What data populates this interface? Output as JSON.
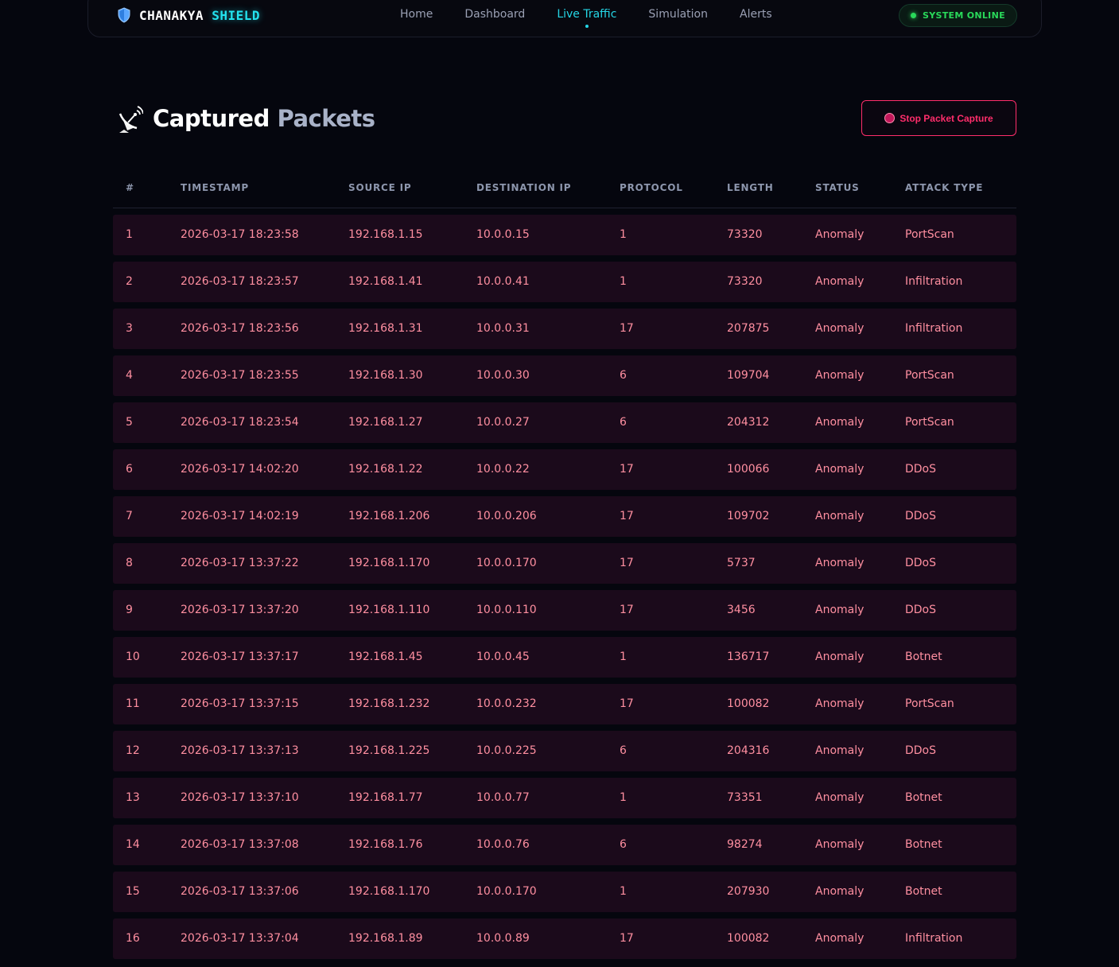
{
  "brand": {
    "name_part1": "CHANAKYA",
    "name_part2": "SHIELD"
  },
  "nav": {
    "links": [
      "Home",
      "Dashboard",
      "Live Traffic",
      "Simulation",
      "Alerts"
    ],
    "active": "Live Traffic"
  },
  "status": {
    "label": "SYSTEM ONLINE",
    "color": "#29d95a"
  },
  "page": {
    "title_part1": "Captured",
    "title_part2": "Packets",
    "icon": "satellite-dish-icon",
    "stop_button_label": "Stop Packet Capture"
  },
  "colors": {
    "accent": "#25d6e6",
    "danger": "#ff2d6b",
    "row_text": "#ff8fa0",
    "row_bg": "#1b0a1b"
  },
  "table": {
    "headers": [
      "#",
      "TIMESTAMP",
      "SOURCE IP",
      "DESTINATION IP",
      "PROTOCOL",
      "LENGTH",
      "STATUS",
      "ATTACK TYPE"
    ],
    "rows": [
      [
        "1",
        "2026-03-17 18:23:58",
        "192.168.1.15",
        "10.0.0.15",
        "1",
        "73320",
        "Anomaly",
        "PortScan"
      ],
      [
        "2",
        "2026-03-17 18:23:57",
        "192.168.1.41",
        "10.0.0.41",
        "1",
        "73320",
        "Anomaly",
        "Infiltration"
      ],
      [
        "3",
        "2026-03-17 18:23:56",
        "192.168.1.31",
        "10.0.0.31",
        "17",
        "207875",
        "Anomaly",
        "Infiltration"
      ],
      [
        "4",
        "2026-03-17 18:23:55",
        "192.168.1.30",
        "10.0.0.30",
        "6",
        "109704",
        "Anomaly",
        "PortScan"
      ],
      [
        "5",
        "2026-03-17 18:23:54",
        "192.168.1.27",
        "10.0.0.27",
        "6",
        "204312",
        "Anomaly",
        "PortScan"
      ],
      [
        "6",
        "2026-03-17 14:02:20",
        "192.168.1.22",
        "10.0.0.22",
        "17",
        "100066",
        "Anomaly",
        "DDoS"
      ],
      [
        "7",
        "2026-03-17 14:02:19",
        "192.168.1.206",
        "10.0.0.206",
        "17",
        "109702",
        "Anomaly",
        "DDoS"
      ],
      [
        "8",
        "2026-03-17 13:37:22",
        "192.168.1.170",
        "10.0.0.170",
        "17",
        "5737",
        "Anomaly",
        "DDoS"
      ],
      [
        "9",
        "2026-03-17 13:37:20",
        "192.168.1.110",
        "10.0.0.110",
        "17",
        "3456",
        "Anomaly",
        "DDoS"
      ],
      [
        "10",
        "2026-03-17 13:37:17",
        "192.168.1.45",
        "10.0.0.45",
        "1",
        "136717",
        "Anomaly",
        "Botnet"
      ],
      [
        "11",
        "2026-03-17 13:37:15",
        "192.168.1.232",
        "10.0.0.232",
        "17",
        "100082",
        "Anomaly",
        "PortScan"
      ],
      [
        "12",
        "2026-03-17 13:37:13",
        "192.168.1.225",
        "10.0.0.225",
        "6",
        "204316",
        "Anomaly",
        "DDoS"
      ],
      [
        "13",
        "2026-03-17 13:37:10",
        "192.168.1.77",
        "10.0.0.77",
        "1",
        "73351",
        "Anomaly",
        "Botnet"
      ],
      [
        "14",
        "2026-03-17 13:37:08",
        "192.168.1.76",
        "10.0.0.76",
        "6",
        "98274",
        "Anomaly",
        "Botnet"
      ],
      [
        "15",
        "2026-03-17 13:37:06",
        "192.168.1.170",
        "10.0.0.170",
        "1",
        "207930",
        "Anomaly",
        "Botnet"
      ],
      [
        "16",
        "2026-03-17 13:37:04",
        "192.168.1.89",
        "10.0.0.89",
        "17",
        "100082",
        "Anomaly",
        "Infiltration"
      ]
    ]
  }
}
